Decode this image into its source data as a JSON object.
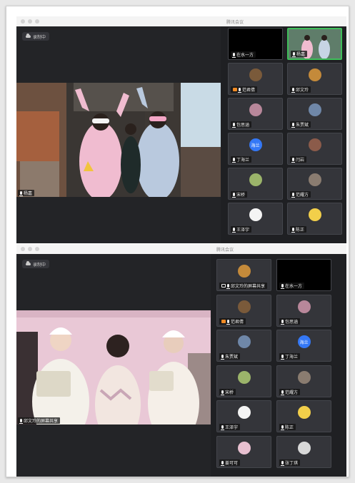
{
  "top_window": {
    "title": "腾讯会议",
    "recording": "录制中",
    "main_speaker": "杨嘉",
    "participants": [
      {
        "name": "在水一方",
        "kind": "black"
      },
      {
        "name": "杨嘉",
        "kind": "photo",
        "active": true
      },
      {
        "name": "范君倩",
        "kind": "avatar",
        "color": "#7a5a3a",
        "host": true
      },
      {
        "name": "邱文玲",
        "kind": "avatar",
        "color": "#c48a3a"
      },
      {
        "name": "包思涵",
        "kind": "avatar",
        "color": "#b8879a"
      },
      {
        "name": "朱贾斌",
        "kind": "avatar",
        "color": "#6f87a8"
      },
      {
        "name": "丁海兰",
        "kind": "text",
        "text": "海兰",
        "color": "#3478f6"
      },
      {
        "name": "闫岩",
        "kind": "avatar",
        "color": "#8b5b4a"
      },
      {
        "name": "宋桥",
        "kind": "avatar",
        "color": "#9bb46a"
      },
      {
        "name": "范耀方",
        "kind": "avatar",
        "color": "#8a7c70"
      },
      {
        "name": "王泽宇",
        "kind": "avatar",
        "color": "#f4f4f4"
      },
      {
        "name": "陈正",
        "kind": "avatar",
        "color": "#f2cf4a"
      }
    ]
  },
  "bottom_window": {
    "title": "腾讯会议",
    "recording": "录制中",
    "main_speaker": "邱文玲的屏幕共享",
    "participants": [
      {
        "name": "邱文玲的屏幕共享",
        "kind": "avatar",
        "color": "#c48a3a",
        "share": true
      },
      {
        "name": "在水一方",
        "kind": "black"
      },
      {
        "name": "范君倩",
        "kind": "avatar",
        "color": "#7a5a3a",
        "host": true
      },
      {
        "name": "包思涵",
        "kind": "avatar",
        "color": "#b8879a"
      },
      {
        "name": "朱贾斌",
        "kind": "avatar",
        "color": "#6f87a8"
      },
      {
        "name": "丁海兰",
        "kind": "text",
        "text": "海兰",
        "color": "#3478f6"
      },
      {
        "name": "宋桥",
        "kind": "avatar",
        "color": "#9bb46a"
      },
      {
        "name": "范耀方",
        "kind": "avatar",
        "color": "#8a7c70"
      },
      {
        "name": "王泽宇",
        "kind": "avatar",
        "color": "#f4f4f4"
      },
      {
        "name": "陈正",
        "kind": "avatar",
        "color": "#f2cf4a"
      },
      {
        "name": "姜可可",
        "kind": "avatar",
        "color": "#e8c0d0"
      },
      {
        "name": "张丁琪",
        "kind": "avatar",
        "color": "#d8d8d8"
      }
    ]
  }
}
